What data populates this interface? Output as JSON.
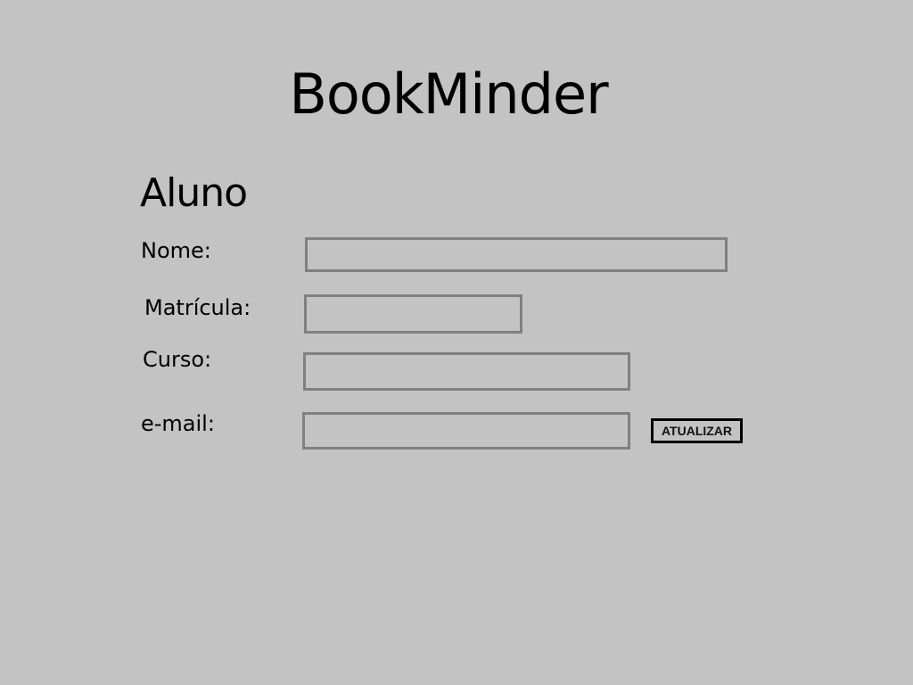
{
  "app": {
    "title": "BookMinder"
  },
  "form": {
    "section_title": "Aluno",
    "fields": {
      "nome": {
        "label": "Nome:",
        "value": "",
        "placeholder": ""
      },
      "matricula": {
        "label": "Matrícula:",
        "value": "",
        "placeholder": ""
      },
      "curso": {
        "label": "Curso:",
        "value": "",
        "placeholder": ""
      },
      "email": {
        "label": "e-mail:",
        "value": "",
        "placeholder": ""
      }
    },
    "update_button_label": "ATUALIZAR"
  },
  "colors": {
    "background": "#c3c3c3",
    "input_border": "#808080",
    "button_border": "#000000",
    "text": "#000000"
  }
}
